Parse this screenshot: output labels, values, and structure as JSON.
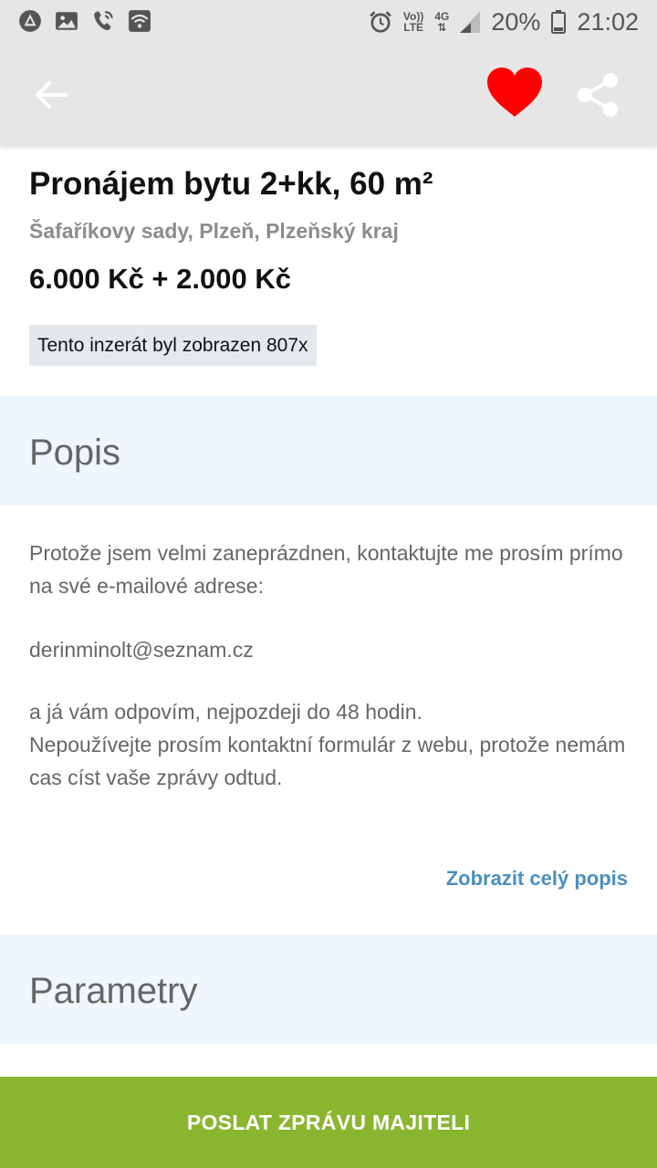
{
  "status_bar": {
    "icons_left": [
      "notification-icon",
      "image-icon",
      "wifi-call-icon",
      "wifi-icon"
    ],
    "alarm_icon": "alarm-icon",
    "volte_label_top": "Vo))",
    "volte_label_bottom": "LTE",
    "network_label": "4G",
    "battery_percent": "20%",
    "time": "21:02"
  },
  "app_bar": {
    "back_icon": "arrow-left-icon",
    "favorite_icon": "heart-icon",
    "favorite_color": "#ff0000",
    "share_icon": "share-icon"
  },
  "listing": {
    "title": "Pronájem bytu 2+kk, 60 m²",
    "location": "Šafaříkovy sady, Plzeň, Plzeňský kraj",
    "price": "6.000 Kč + 2.000 Kč",
    "view_count_label": "Tento inzerát byl zobrazen 807x"
  },
  "description_section": {
    "heading": "Popis",
    "paragraph1": "Protože jsem velmi zaneprázdnen, kontaktujte me prosím prímo na své e-mailové adrese:",
    "email": "derinminolt@seznam.cz",
    "paragraph2_line1": "a já vám odpovím, nejpozdeji do 48 hodin.",
    "paragraph2_line2": "Nepoužívejte prosím kontaktní formulár z webu, protože nemám cas císt vaše zprávy odtud.",
    "show_more_label": "Zobrazit celý popis"
  },
  "parameters_section": {
    "heading": "Parametry"
  },
  "cta": {
    "label": "POSLAT ZPRÁVU MAJITELI",
    "color": "#8ab62f"
  }
}
